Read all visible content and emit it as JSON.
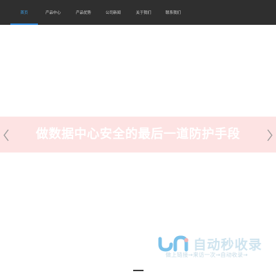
{
  "header": {
    "background": "#2f2f2f",
    "nav": [
      {
        "label": "首页",
        "active": true
      },
      {
        "label": "产品中心",
        "active": false
      },
      {
        "label": "产品优势",
        "active": false
      },
      {
        "label": "公司新闻",
        "active": false
      },
      {
        "label": "关于我们",
        "active": false
      },
      {
        "label": "联系我们",
        "active": false
      }
    ],
    "active_color": "#3da0e8"
  },
  "banner": {
    "text": "做数据中心安全的最后一道防护手段",
    "background": "#fde3e3",
    "prev_icon": "chevron-left-icon",
    "next_icon": "chevron-right-icon"
  },
  "watermark": {
    "title": "自动秒收录",
    "slogan": "做上链接→来访一次→自动收录→",
    "color": "#cfe4ef"
  }
}
